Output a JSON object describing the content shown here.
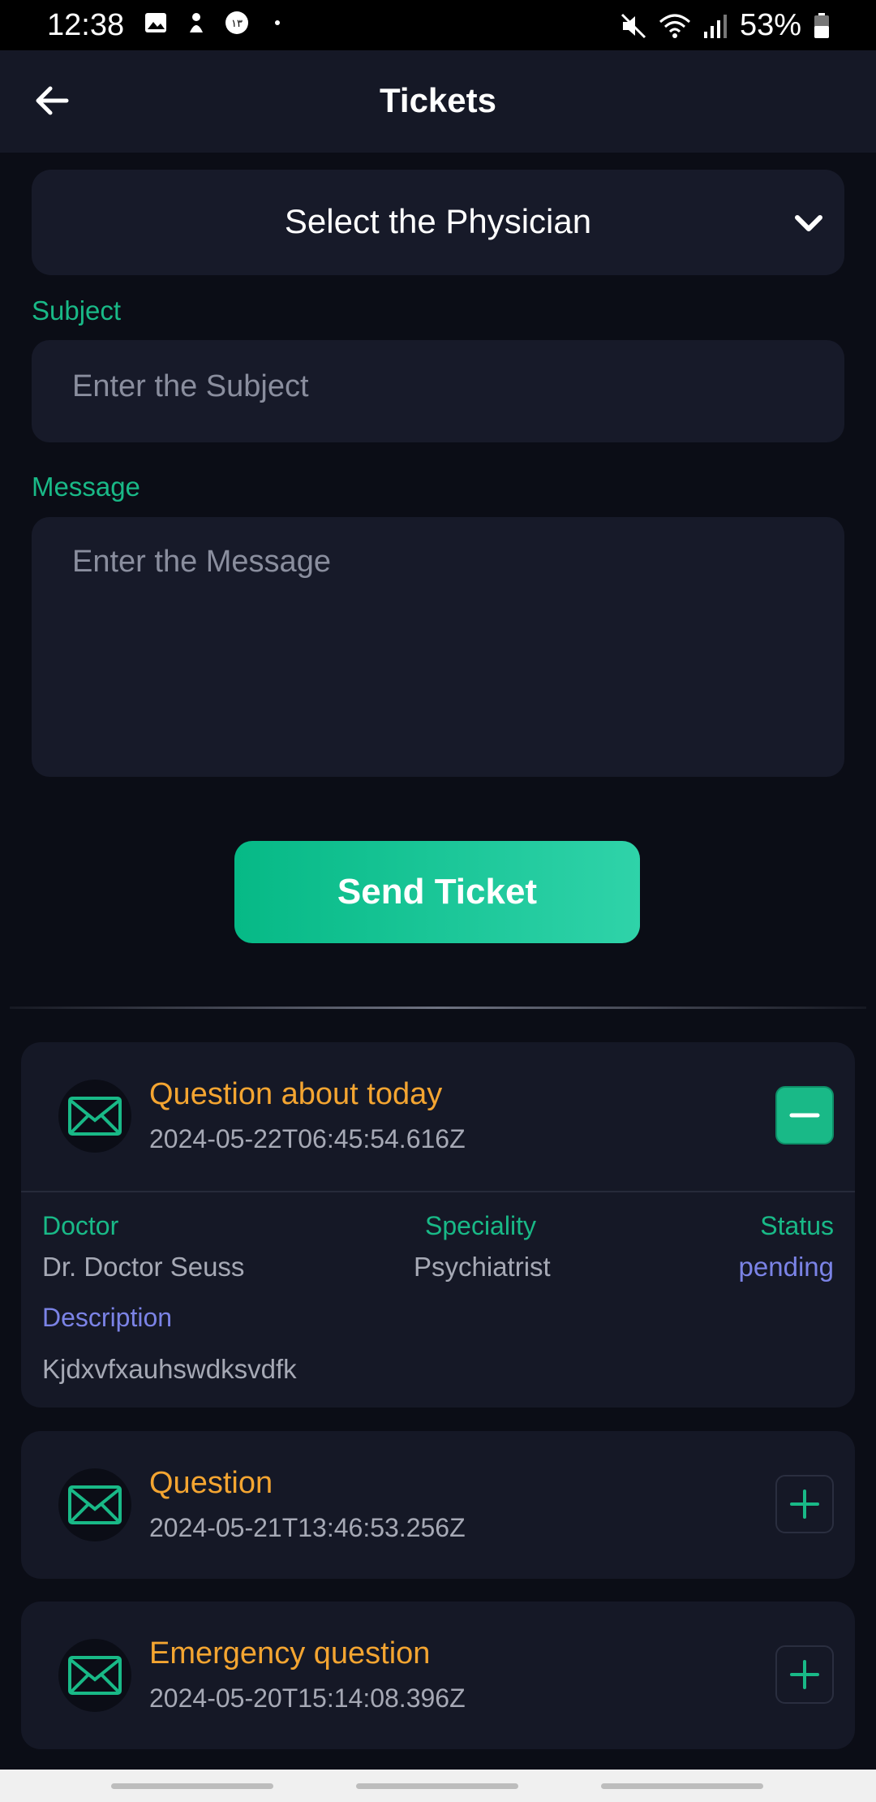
{
  "status_bar": {
    "time": "12:38",
    "battery": "53%",
    "icons": [
      "image-icon",
      "notification-icon",
      "badge-icon",
      "dot-icon",
      "mute-icon",
      "wifi-icon",
      "signal-icon",
      "battery-icon"
    ]
  },
  "header": {
    "title": "Tickets",
    "back_icon": "arrow-left-icon"
  },
  "form": {
    "physician_select": "Select the Physician",
    "subject_label": "Subject",
    "subject_placeholder": "Enter the Subject",
    "message_label": "Message",
    "message_placeholder": "Enter the Message",
    "send_label": "Send Ticket"
  },
  "tickets": [
    {
      "title": "Question about today",
      "date": "2024-05-22T06:45:54.616Z",
      "expanded": true,
      "doctor_label": "Doctor",
      "doctor": "Dr. Doctor Seuss",
      "speciality_label": "Speciality",
      "speciality": "Psychiatrist",
      "status_label": "Status",
      "status": "pending",
      "description_label": "Description",
      "description": "Kjdxvfxauhswdksvdfk"
    },
    {
      "title": "Question",
      "date": "2024-05-21T13:46:53.256Z",
      "expanded": false
    },
    {
      "title": "Emergency question",
      "date": "2024-05-20T15:14:08.396Z",
      "expanded": false
    }
  ],
  "colors": {
    "accent": "#19b987",
    "ticket_title": "#f4a531",
    "status": "#7b83e6",
    "background": "#0b0d16",
    "surface": "#151826"
  }
}
